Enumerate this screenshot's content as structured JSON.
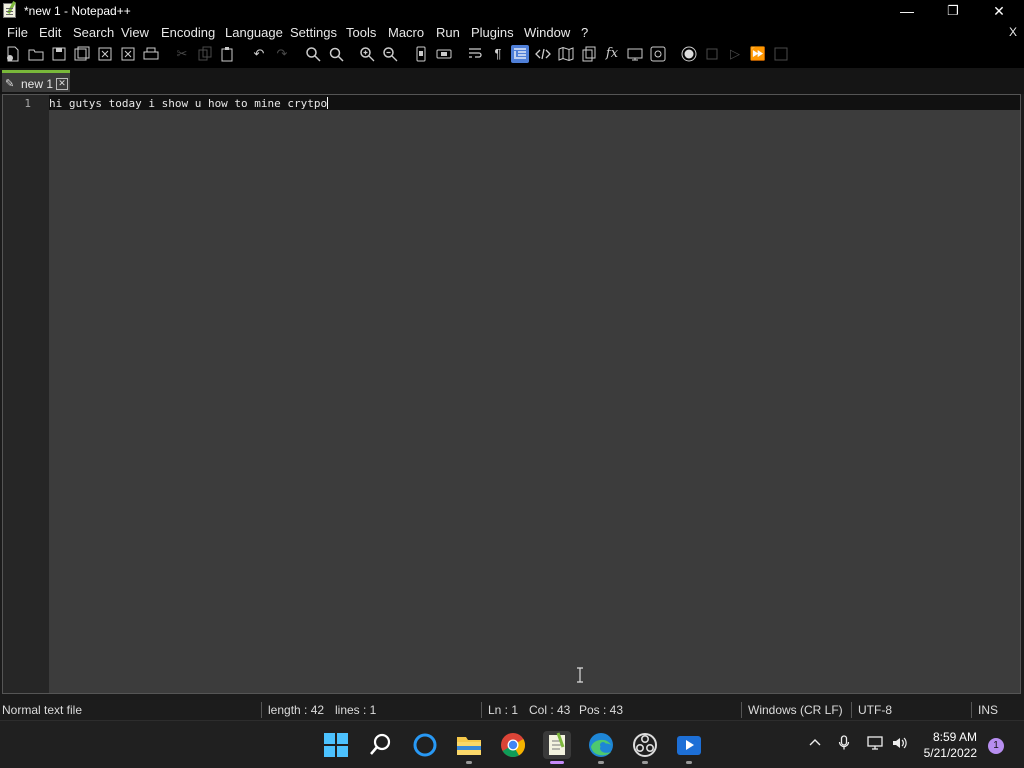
{
  "window": {
    "title": "*new 1 - Notepad++",
    "minimize": "—",
    "maximize": "❐",
    "close": "✕"
  },
  "menu": {
    "items": [
      "File",
      "Edit",
      "Search",
      "View",
      "Encoding",
      "Language",
      "Settings",
      "Tools",
      "Macro",
      "Run",
      "Plugins",
      "Window",
      "?"
    ],
    "close_doc": "X"
  },
  "toolbar": {
    "icons": [
      "new-file",
      "open-file",
      "save",
      "save-all",
      "close",
      "close-all",
      "print",
      "cut",
      "copy",
      "paste",
      "undo",
      "redo",
      "find",
      "replace",
      "zoom-in",
      "zoom-out",
      "sync-vertical",
      "sync-horizontal",
      "word-wrap",
      "show-all-chars",
      "indent-guide",
      "udl",
      "document-map",
      "document-list",
      "function-list",
      "folder-as-workspace",
      "monitoring",
      "record-macro",
      "stop-record",
      "play-macro",
      "run-macro-multiple",
      "save-macro"
    ],
    "active": "indent-guide"
  },
  "tab": {
    "label": "new 1",
    "close": "✕",
    "accent": "#79b83a"
  },
  "editor": {
    "line_number": "1",
    "text": "hi gutys today i show u how to mine crytpo"
  },
  "status": {
    "file_type": "Normal text file",
    "length": "length : 42",
    "lines": "lines : 1",
    "ln": "Ln : 1",
    "col": "Col : 43",
    "pos": "Pos : 43",
    "eol": "Windows (CR LF)",
    "encoding": "UTF-8",
    "mode": "INS"
  },
  "taskbar": {
    "apps": [
      "start-icon",
      "search-icon",
      "cortana-icon",
      "file-explorer-icon",
      "chrome-icon",
      "notepadpp-icon",
      "edge-icon",
      "obs-icon",
      "media-player-icon"
    ],
    "time": "8:59 AM",
    "date": "5/21/2022",
    "notifications": "1"
  }
}
